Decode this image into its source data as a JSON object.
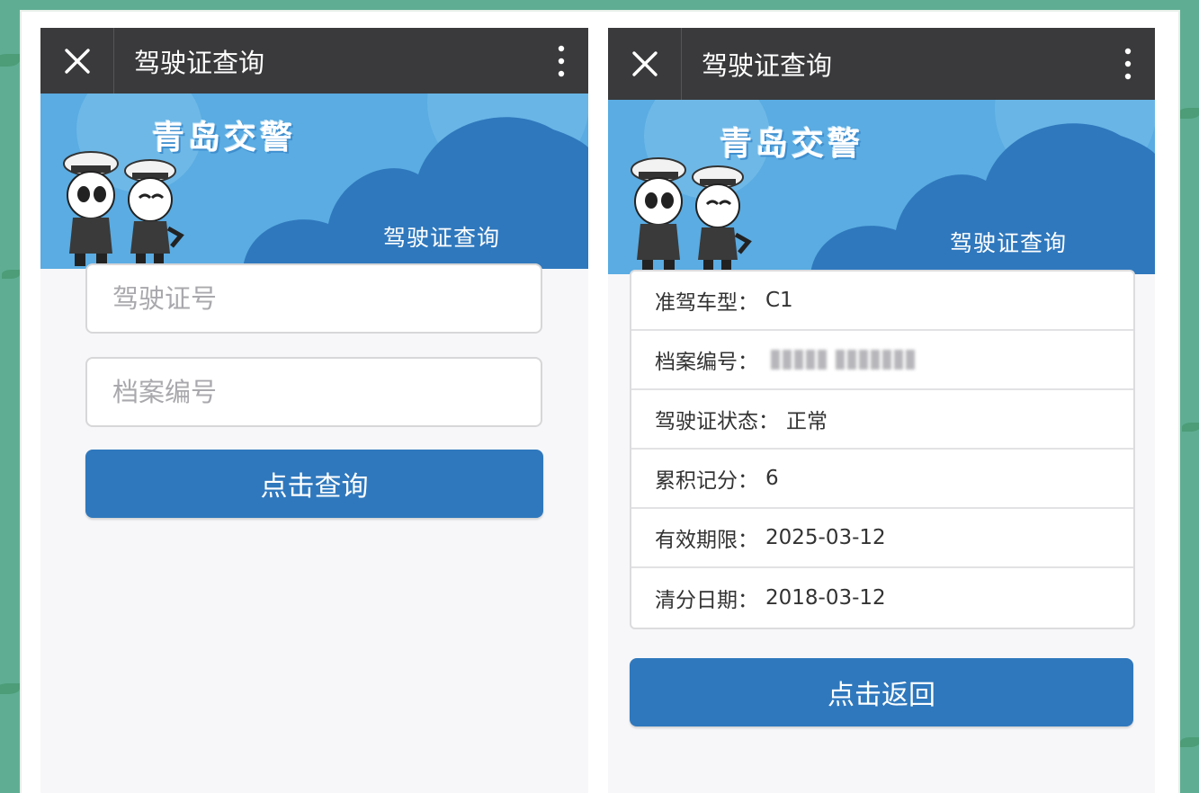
{
  "colors": {
    "titlebar": "#3a3a3c",
    "banner": "#5aace2",
    "cloud": "#2f78bd",
    "button": "#2f78bd",
    "page_bg": "#f7f7f9"
  },
  "left_screen": {
    "title": "驾驶证查询",
    "banner": {
      "title": "青岛交警",
      "subtitle": "驾驶证查询"
    },
    "license_input": {
      "placeholder": "驾驶证号",
      "value": ""
    },
    "archive_input": {
      "placeholder": "档案编号",
      "value": ""
    },
    "query_button": "点击查询"
  },
  "right_screen": {
    "title": "驾驶证查询",
    "banner": {
      "title": "青岛交警",
      "subtitle": "驾驶证查询"
    },
    "rows": [
      {
        "label": "准驾车型：",
        "value": "C1"
      },
      {
        "label": "档案编号：",
        "value": ""
      },
      {
        "label": "驾驶证状态：",
        "value": "正常"
      },
      {
        "label": "累积记分：",
        "value": "6"
      },
      {
        "label": "有效期限：",
        "value": "2025-03-12"
      },
      {
        "label": "清分日期：",
        "value": "2018-03-12"
      }
    ],
    "back_button": "点击返回"
  },
  "icons": [
    "close-icon",
    "more-vertical-icon",
    "police-mascot-icon"
  ]
}
